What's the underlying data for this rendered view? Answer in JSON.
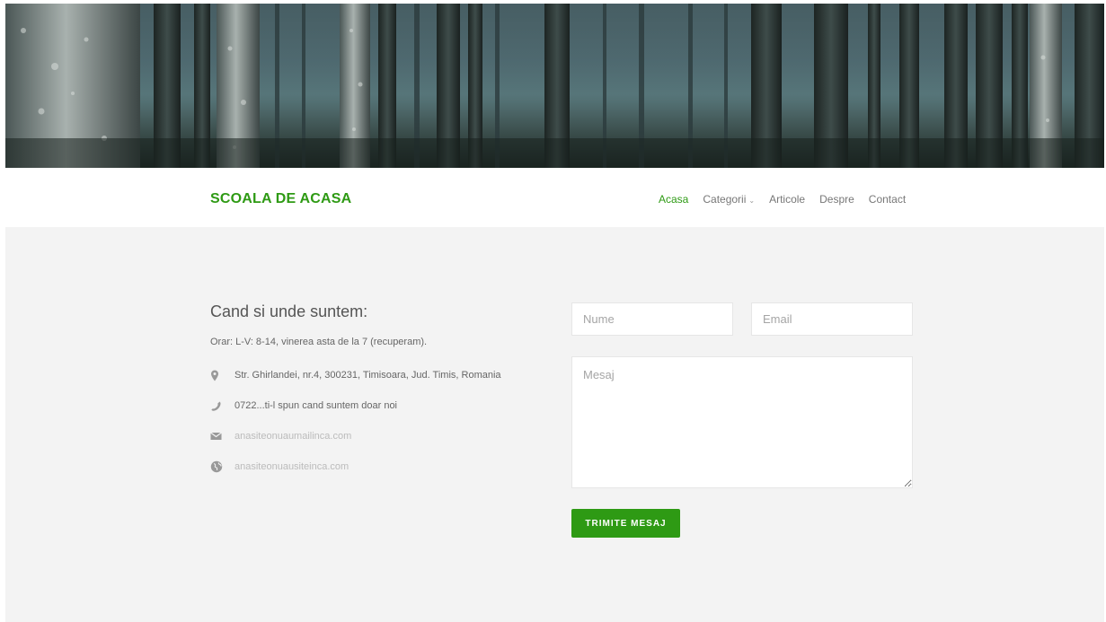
{
  "header": {
    "logo": "SCOALA DE ACASA",
    "nav": [
      {
        "label": "Acasa",
        "active": true
      },
      {
        "label": "Categorii",
        "dropdown": true
      },
      {
        "label": "Articole"
      },
      {
        "label": "Despre"
      },
      {
        "label": "Contact"
      }
    ]
  },
  "contact": {
    "title": "Cand si unde suntem:",
    "hours": "Orar: L-V: 8-14, vinerea asta de la 7 (recuperam).",
    "address": "Str. Ghirlandei, nr.4, 300231, Timisoara, Jud. Timis, Romania",
    "phone": "0722...ti-l spun cand suntem doar noi",
    "email": "anasiteonuaumailinca.com",
    "website": "anasiteonuausiteinca.com",
    "icons": [
      "map-pin-icon",
      "phone-icon",
      "envelope-icon",
      "globe-icon"
    ]
  },
  "form": {
    "name_placeholder": "Nume",
    "email_placeholder": "Email",
    "message_placeholder": "Mesaj",
    "submit_label": "TRIMITE MESAJ"
  },
  "colors": {
    "accent": "#2e9a14",
    "background": "#f3f3f3"
  }
}
